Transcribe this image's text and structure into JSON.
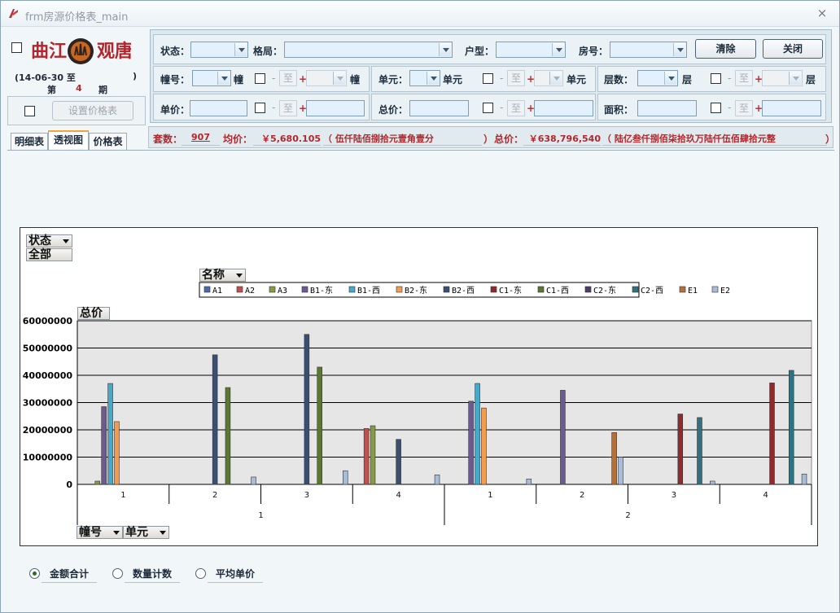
{
  "window": {
    "title": "frm房源价格表_main",
    "close": "×"
  },
  "brand": {
    "text_left": "曲江",
    "text_right": "观唐"
  },
  "period": {
    "date": "(14-06-30 至",
    "close_paren": ")",
    "prefix": "第",
    "number": "4",
    "suffix": "期"
  },
  "set_price_button": "设置价格表",
  "tabs": [
    {
      "label": "明细表"
    },
    {
      "label": "透视图"
    },
    {
      "label": "价格表"
    }
  ],
  "filters": {
    "status_label": "状态：",
    "layout_label": "格局：",
    "unit_type_label": "户型：",
    "room_label": "房号：",
    "clear_button": "清除",
    "close_button": "关闭",
    "building_label": "幢号：",
    "building_unit": "幢",
    "unit_label": "单元：",
    "unit_unit": "单元",
    "floor_label": "层数：",
    "floor_unit": "层",
    "price_label": "单价：",
    "total_label": "总价：",
    "area_label": "面积：",
    "range_from": "至",
    "dash": "-",
    "plus": "+"
  },
  "summary": {
    "count_label": "套数：",
    "count": "907",
    "avg_label": "均价：",
    "avg": "￥5,680.105",
    "avg_words": "（ 伍仟陆佰捌拾元壹角壹分",
    "paren_close": "）",
    "total_label": "总价：",
    "total": "￥638,796,540",
    "total_words": "（ 陆亿叁仟捌佰柒拾玖万陆仟伍佰肆拾元整",
    "total_close": "）"
  },
  "pivot": {
    "filter_field": "状态",
    "filter_value": "全部",
    "series_field": "名称",
    "data_field": "总价",
    "row_fields": [
      "幢号",
      "单元"
    ]
  },
  "options": [
    {
      "label": "金额合计",
      "selected": true
    },
    {
      "label": "数量计数",
      "selected": false
    },
    {
      "label": "平均单价",
      "selected": false
    }
  ],
  "chart_data": {
    "type": "bar",
    "ylim": [
      0,
      60000000
    ],
    "yticks": [
      "0",
      "10000000",
      "20000000",
      "30000000",
      "40000000",
      "50000000",
      "60000000"
    ],
    "grid": true,
    "legend": "top",
    "categories": [
      "1-1",
      "1-2",
      "1-3",
      "1-4",
      "2-1",
      "2-2",
      "2-3",
      "2-4"
    ],
    "x_inner_labels": [
      "1",
      "2",
      "3",
      "4",
      "1",
      "2",
      "3",
      "4"
    ],
    "x_outer_labels": [
      "1",
      "2"
    ],
    "series": [
      {
        "name": "A1",
        "color": "#4b6aa8",
        "values": [
          0,
          0,
          0,
          0,
          0,
          0,
          0,
          0
        ]
      },
      {
        "name": "A2",
        "color": "#c0504d",
        "values": [
          0,
          0,
          0,
          20500000,
          0,
          0,
          0,
          0
        ]
      },
      {
        "name": "A3",
        "color": "#859b48",
        "values": [
          1200000,
          0,
          0,
          21500000,
          0,
          0,
          0,
          0
        ]
      },
      {
        "name": "B1-东",
        "color": "#6c5a91",
        "values": [
          28500000,
          0,
          0,
          0,
          30500000,
          34500000,
          0,
          0
        ]
      },
      {
        "name": "B1-西",
        "color": "#47a8c8",
        "values": [
          37000000,
          0,
          0,
          0,
          37000000,
          0,
          0,
          0
        ]
      },
      {
        "name": "B2-东",
        "color": "#f39c4e",
        "values": [
          23000000,
          0,
          0,
          0,
          28000000,
          0,
          0,
          0
        ]
      },
      {
        "name": "B2-西",
        "color": "#3b4f72",
        "values": [
          0,
          47500000,
          55000000,
          16500000,
          0,
          0,
          0,
          0
        ]
      },
      {
        "name": "C1-东",
        "color": "#8e2b2e",
        "values": [
          0,
          0,
          0,
          0,
          0,
          0,
          25800000,
          37200000
        ]
      },
      {
        "name": "C1-西",
        "color": "#5e7633",
        "values": [
          0,
          35500000,
          43000000,
          0,
          0,
          0,
          0,
          0
        ]
      },
      {
        "name": "C2-东",
        "color": "#4b3e68",
        "values": [
          0,
          0,
          0,
          0,
          0,
          0,
          0,
          0
        ]
      },
      {
        "name": "C2-西",
        "color": "#2f7383",
        "values": [
          0,
          0,
          0,
          0,
          0,
          0,
          24500000,
          41800000
        ]
      },
      {
        "name": "E1",
        "color": "#b4703a",
        "values": [
          0,
          0,
          0,
          0,
          0,
          19000000,
          0,
          0
        ]
      },
      {
        "name": "E2",
        "color": "#a9bcd8",
        "values": [
          0,
          2700000,
          5000000,
          3500000,
          2000000,
          10000000,
          1200000,
          3800000
        ]
      }
    ]
  }
}
